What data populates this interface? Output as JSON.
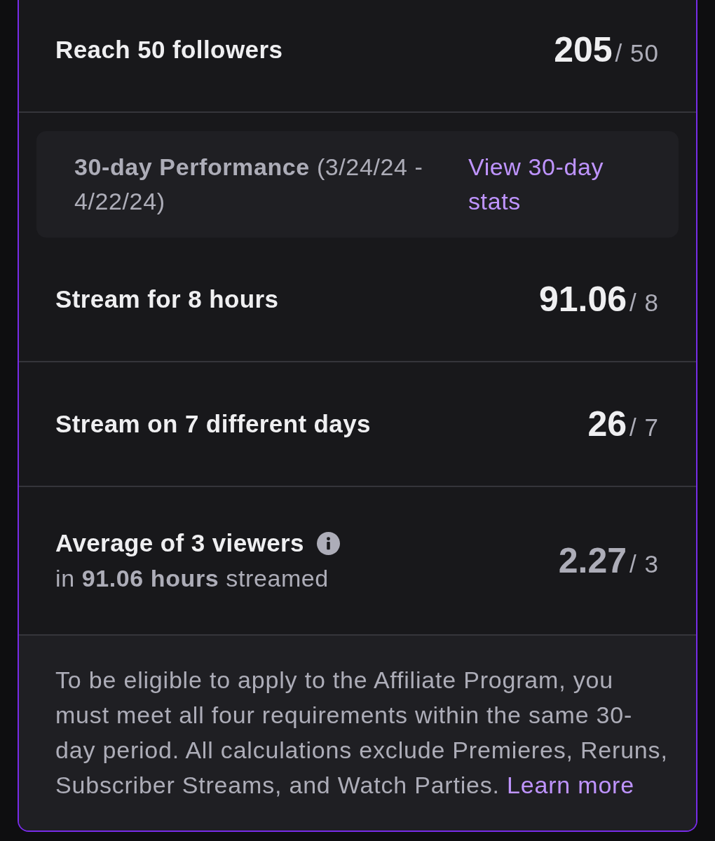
{
  "card": {
    "sections": [
      {
        "kind": "requirement",
        "title": "Reach 50 followers",
        "current": "205",
        "goal": "/ 50",
        "met": true,
        "info": false
      },
      {
        "kind": "period",
        "text": "**30-day Performance** (3/24/24 - 4/22/24)",
        "link": "View 30-day stats"
      },
      {
        "kind": "requirement",
        "title": "Stream for 8 hours",
        "current": "91.06",
        "goal": "/ 8",
        "met": true,
        "info": false
      },
      {
        "kind": "requirement",
        "title": "Stream on 7 different days",
        "current": "26",
        "goal": "/ 7",
        "met": true,
        "info": false
      },
      {
        "kind": "requirement",
        "title": "Average of 3 viewers",
        "subtitle": "in **91.06 hours** streamed",
        "current": "2.27",
        "goal": "/ 3",
        "met": false,
        "info": true
      }
    ],
    "footer": {
      "text": "To be eligible to apply to the Affiliate Program, you must meet all four requirements within the same 30-day period. All calculations exclude Premieres, Reruns, Subscriber Streams, and Watch Parties.",
      "link": "Learn more"
    }
  }
}
